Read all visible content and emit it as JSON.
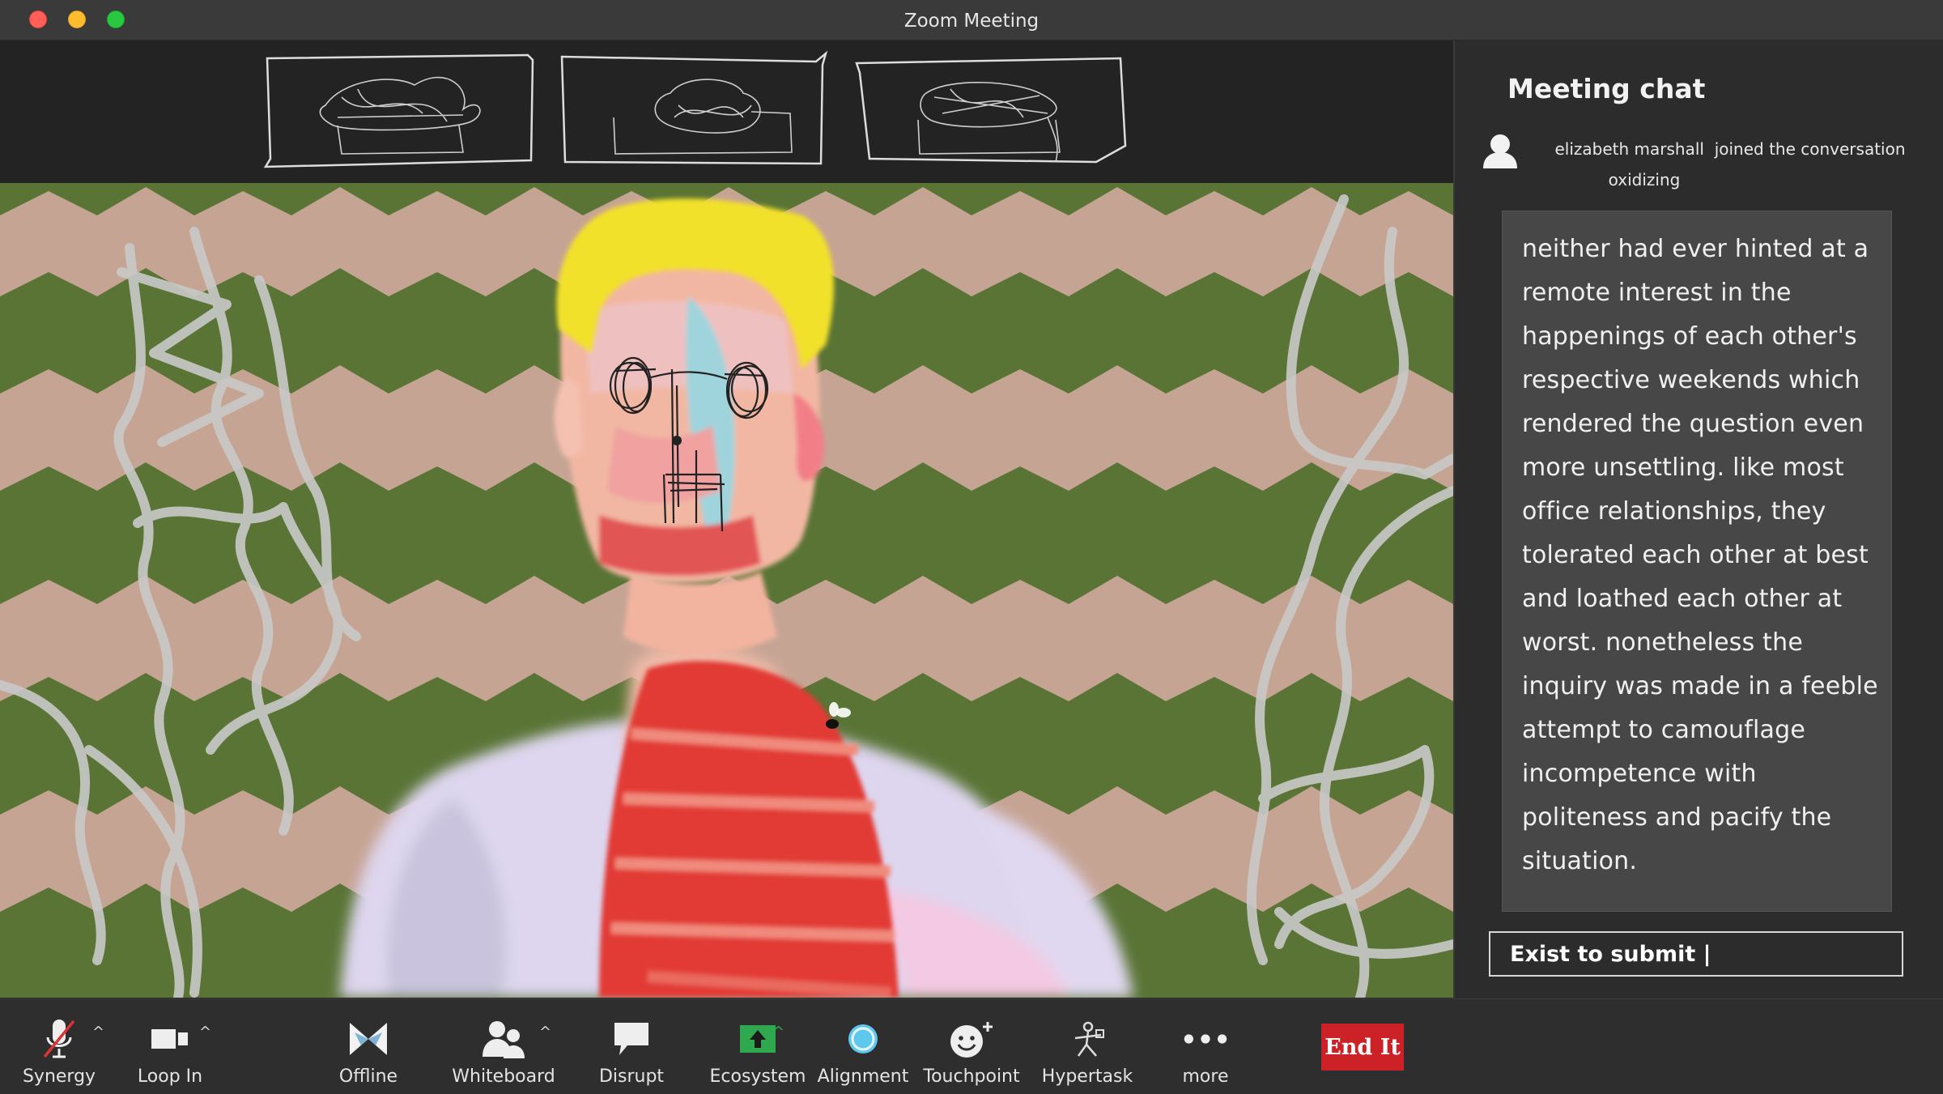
{
  "window": {
    "title": "Zoom Meeting"
  },
  "chat": {
    "title": "Meeting chat",
    "join": {
      "user": "elizabeth marshall",
      "action": "joined the conversation",
      "status": "oxidizing"
    },
    "message": "neither had ever hinted at a remote interest in the happenings of each other's respective weekends which rendered the question even more unsettling. like most office relationships, they tolerated each other at best and loathed each other at worst. nonetheless the inquiry was made in a feeble attempt to camouflage incompetence with politeness and pacify the situation.",
    "input_value": "Exist to submit |"
  },
  "toolbar": {
    "synergy": "Synergy",
    "loop_in": "Loop In",
    "offline": "Offline",
    "whiteboard": "Whiteboard",
    "disrupt": "Disrupt",
    "ecosystem": "Ecosystem",
    "alignment": "Alignment",
    "touchpoint": "Touchpoint",
    "hypertask": "Hypertask",
    "more": "more",
    "end": "End It"
  },
  "colors": {
    "end_button": "#cc2127",
    "ecosystem_icon": "#2fa84f",
    "alignment_icon": "#5ec8ef",
    "traffic_close": "#ff5f57",
    "traffic_min": "#febc2e",
    "traffic_max": "#28c840"
  },
  "icons": [
    "muted-microphone-icon",
    "video-camera-icon",
    "bowtie-icon",
    "people-icon",
    "speech-bubble-icon",
    "upload-arrow-icon",
    "circle-icon",
    "smiley-plus-icon",
    "stick-figure-icon",
    "ellipsis-icon"
  ]
}
